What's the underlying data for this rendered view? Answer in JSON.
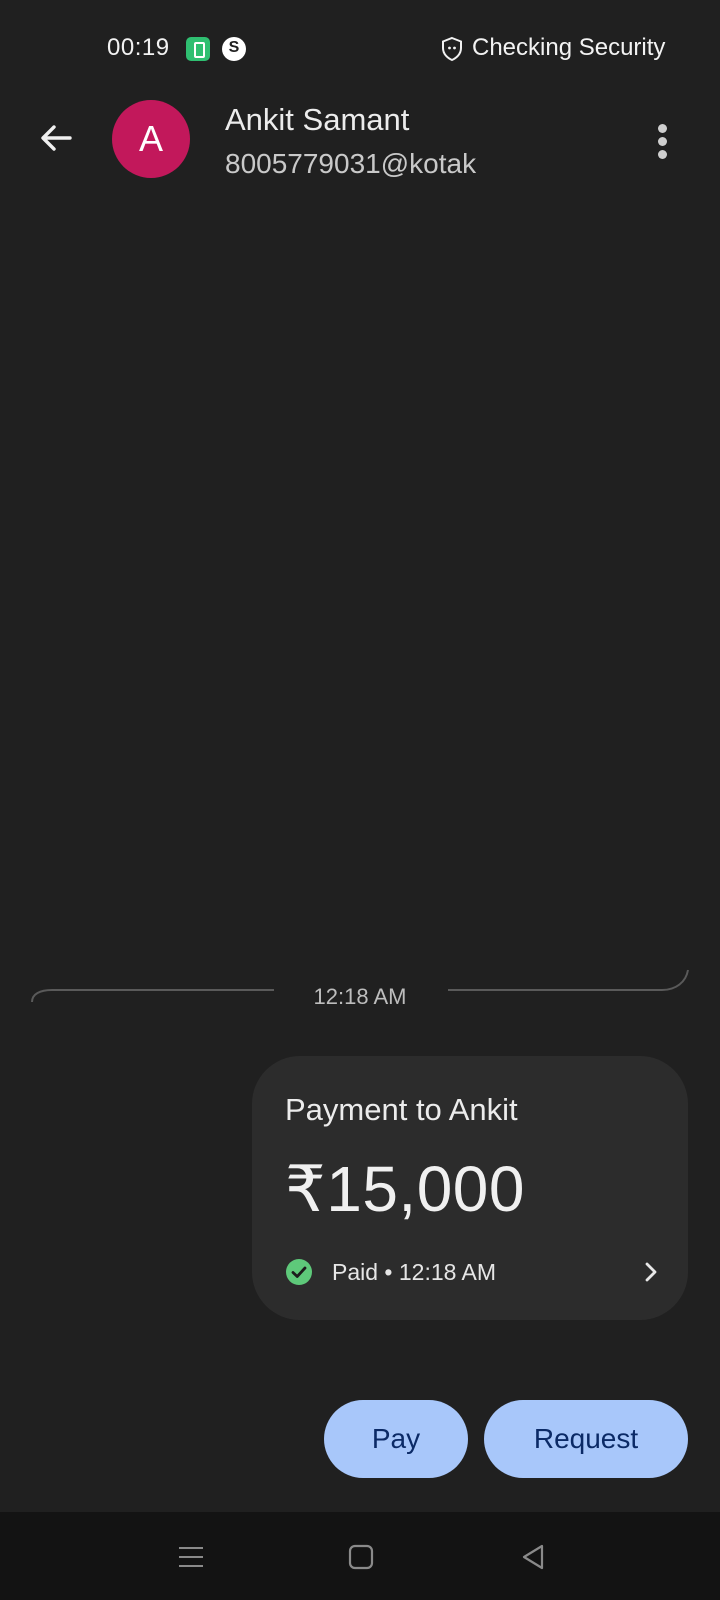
{
  "status_bar": {
    "time": "00:19",
    "right_text": "Checking Security",
    "icons": [
      "battery-saver-icon",
      "shazam-icon",
      "shield-icon"
    ]
  },
  "header": {
    "avatar_letter": "A",
    "name": "Ankit Samant",
    "upi_id": "8005779031@kotak",
    "icons": [
      "back-arrow-icon",
      "more-vert-icon"
    ]
  },
  "conversation": {
    "timestamp": "12:18 AM",
    "payment": {
      "title": "Payment to Ankit",
      "amount": "₹15,000",
      "status": "Paid • 12:18 AM",
      "icons": [
        "check-circle-icon",
        "chevron-right-icon"
      ]
    }
  },
  "actions": {
    "pay_label": "Pay",
    "request_label": "Request"
  },
  "nav_bar": {
    "icons": [
      "recents-menu-icon",
      "home-square-icon",
      "back-triangle-icon"
    ]
  },
  "colors": {
    "background": "#202020",
    "avatar": "#c2185b",
    "button": "#a8c7fa",
    "button_text": "#0b2a66",
    "success": "#5ec97a",
    "card": "#2c2c2c"
  }
}
